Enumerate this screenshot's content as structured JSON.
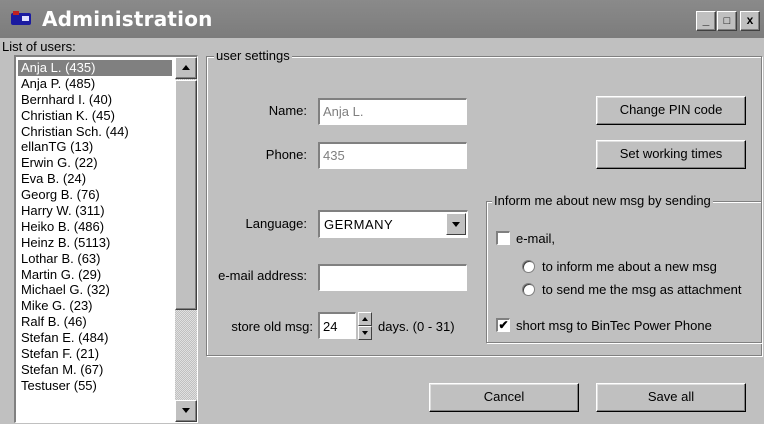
{
  "window": {
    "title": "Administration",
    "minimize_label": "_",
    "maximize_label": "□",
    "close_label": "x"
  },
  "users": {
    "label": "List of users:",
    "items": [
      "Anja L. (435)",
      "Anja P. (485)",
      "Bernhard I. (40)",
      "Christian K. (45)",
      "Christian Sch. (44)",
      "ellanTG (13)",
      "Erwin G. (22)",
      "Eva B. (24)",
      "Georg B. (76)",
      "Harry W. (311)",
      "Heiko B. (486)",
      "Heinz B. (5113)",
      "Lothar B. (63)",
      "Martin G. (29)",
      "Michael G. (32)",
      "Mike G. (23)",
      "Ralf B. (46)",
      "Stefan E. (484)",
      "Stefan F. (21)",
      "Stefan M. (67)",
      "Testuser (55)"
    ],
    "selected": "Anja L. (435)"
  },
  "settings": {
    "group_label": "user settings",
    "name_label": "Name:",
    "name_value": "Anja L.",
    "phone_label": "Phone:",
    "phone_value": "435",
    "language_label": "Language:",
    "language_value": "GERMANY",
    "email_label": "e-mail address:",
    "email_value": "",
    "store_label": "store old msg:",
    "store_value": "24",
    "store_suffix": "days. (0 - 31)",
    "change_pin_label": "Change PIN code",
    "working_times_label": "Set working times"
  },
  "inform": {
    "group_label": "Inform me about new msg by sending",
    "email_option": "e-mail,",
    "email_checked": false,
    "radio_new_msg": "to inform me about a new msg",
    "radio_attachment": "to send me the msg as attachment",
    "short_msg_option": "short msg to BinTec Power Phone",
    "short_msg_checked": true,
    "check_mark": "✔"
  },
  "footer": {
    "cancel_label": "Cancel",
    "save_label": "Save all"
  }
}
